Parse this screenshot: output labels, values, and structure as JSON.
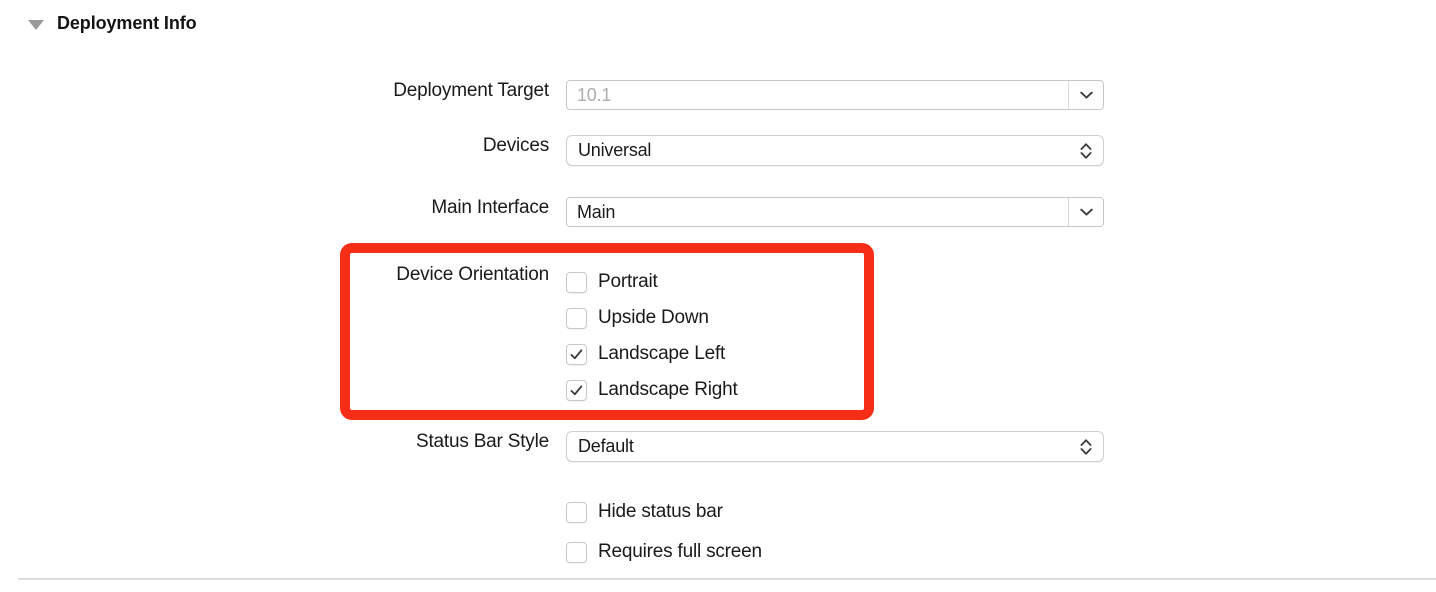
{
  "section": {
    "title": "Deployment Info",
    "disclosure_icon": "triangle-down-icon",
    "expanded": true
  },
  "fields": {
    "deployment_target": {
      "label": "Deployment Target",
      "value": "10.1",
      "is_placeholder": true,
      "control": "combobox",
      "icon": "chevron-down-icon"
    },
    "devices": {
      "label": "Devices",
      "value": "Universal",
      "control": "popup-button",
      "icon": "chevron-up-down-icon"
    },
    "main_interface": {
      "label": "Main Interface",
      "value": "Main",
      "is_placeholder": false,
      "control": "combobox",
      "icon": "chevron-down-icon"
    },
    "device_orientation": {
      "label": "Device Orientation",
      "options": [
        {
          "label": "Portrait",
          "checked": false
        },
        {
          "label": "Upside Down",
          "checked": false
        },
        {
          "label": "Landscape Left",
          "checked": true
        },
        {
          "label": "Landscape Right",
          "checked": true
        }
      ]
    },
    "status_bar_style": {
      "label": "Status Bar Style",
      "value": "Default",
      "control": "popup-button",
      "icon": "chevron-up-down-icon"
    },
    "extra_options": [
      {
        "label": "Hide status bar",
        "checked": false
      },
      {
        "label": "Requires full screen",
        "checked": false
      }
    ]
  },
  "annotation": {
    "name": "device-orientation-highlight",
    "color": "#f62e17",
    "shape": "rounded-rectangle"
  },
  "colors": {
    "text": "#1a1a1a",
    "placeholder": "#adadad",
    "border": "#c6c6c6",
    "separator": "#dcdcdc",
    "checkmark": "#3b3b3b",
    "highlight": "#f62e17"
  }
}
